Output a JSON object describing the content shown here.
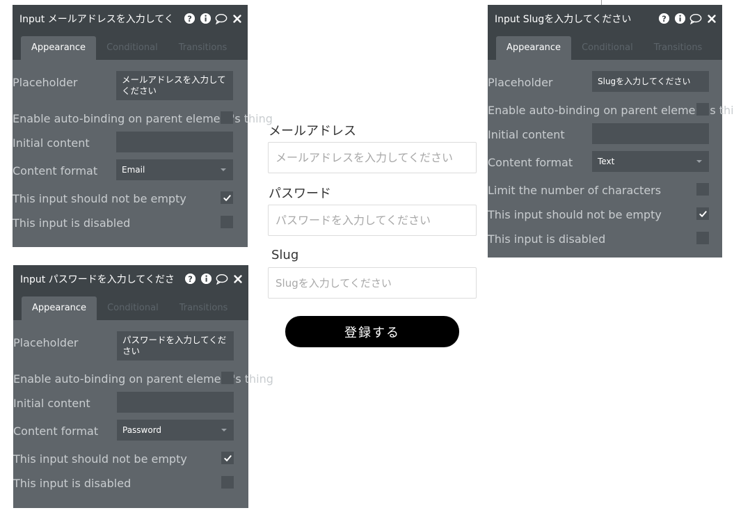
{
  "panels": {
    "email": {
      "title": "Input メールアドレスを入力してく",
      "tabs": [
        "Appearance",
        "Conditional",
        "Transitions"
      ],
      "props": {
        "placeholder_label": "Placeholder",
        "placeholder_value": "メールアドレスを入力してください",
        "autobind_label": "Enable auto-binding on parent element's thing",
        "initial_label": "Initial content",
        "initial_value": "",
        "format_label": "Content format",
        "format_value": "Email",
        "not_empty_label": "This input should not be empty",
        "disabled_label": "This input is disabled"
      }
    },
    "password": {
      "title": "Input パスワードを入力してくださ",
      "tabs": [
        "Appearance",
        "Conditional",
        "Transitions"
      ],
      "props": {
        "placeholder_label": "Placeholder",
        "placeholder_value": "パスワードを入力してください",
        "autobind_label": "Enable auto-binding on parent element's thing",
        "initial_label": "Initial content",
        "initial_value": "",
        "format_label": "Content format",
        "format_value": "Password",
        "not_empty_label": "This input should not be empty",
        "disabled_label": "This input is disabled"
      }
    },
    "slug": {
      "title": "Input Slugを入力してください",
      "tabs": [
        "Appearance",
        "Conditional",
        "Transitions"
      ],
      "props": {
        "placeholder_label": "Placeholder",
        "placeholder_value": "Slugを入力してください",
        "autobind_label": "Enable auto-binding on parent element's thing",
        "initial_label": "Initial content",
        "initial_value": "",
        "format_label": "Content format",
        "format_value": "Text",
        "limit_label": "Limit the number of characters",
        "not_empty_label": "This input should not be empty",
        "disabled_label": "This input is disabled"
      }
    }
  },
  "header_icons": [
    "help-icon",
    "info-icon",
    "comment-icon",
    "close-icon"
  ],
  "form": {
    "email_label": "メールアドレス",
    "email_placeholder": "メールアドレスを入力してください",
    "password_label": "パスワード",
    "password_placeholder": "パスワードを入力してください",
    "slug_label": "Slug",
    "slug_placeholder": "Slugを入力してください",
    "submit_label": "登録する"
  },
  "colors": {
    "panel_bg": "#5f656a",
    "panel_header": "#3e4448",
    "field_bg": "#4b5156",
    "button_bg": "#000000"
  }
}
